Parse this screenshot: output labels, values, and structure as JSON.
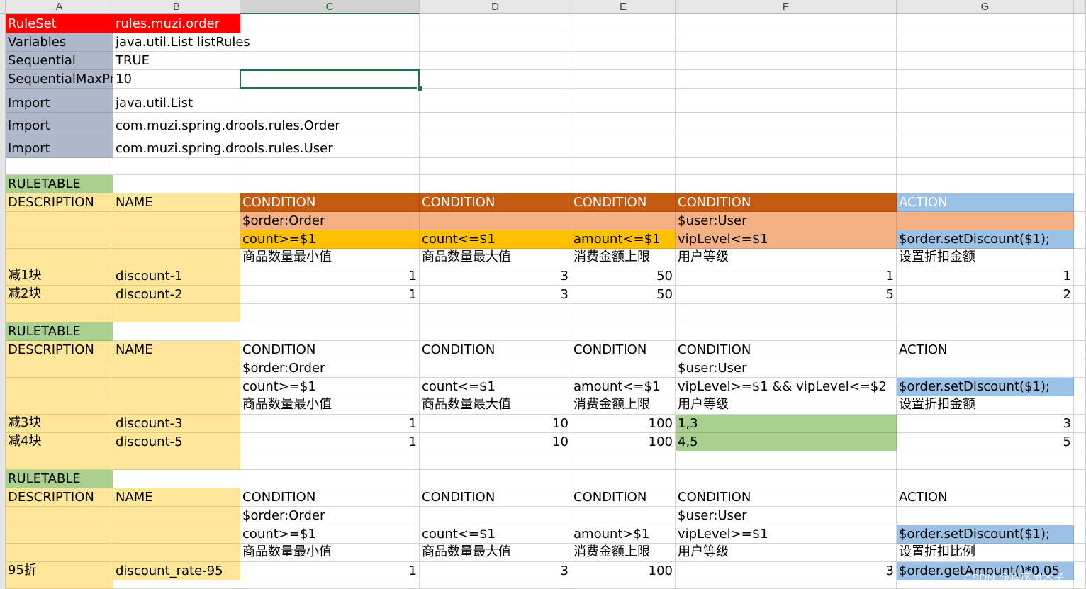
{
  "columns": [
    "A",
    "B",
    "C",
    "D",
    "E",
    "F",
    "G"
  ],
  "active_column": "C",
  "colors": {
    "red": "#ff0000",
    "gray_blue": "#adb9ca",
    "green": "#a9d08e",
    "light_yellow": "#ffe699",
    "dark_orange": "#c55a11",
    "salmon": "#f4b183",
    "gold": "#ffc000",
    "light_blue": "#9bc2e6",
    "white": "#ffffff"
  },
  "rows": [
    [
      {
        "t": "RuleSet",
        "bg": "red",
        "fc": "white"
      },
      {
        "t": "rules.muzi.order",
        "bg": "red",
        "fc": "white"
      },
      {
        "t": ""
      },
      {
        "t": ""
      },
      {
        "t": ""
      },
      {
        "t": ""
      },
      {
        "t": ""
      }
    ],
    [
      {
        "t": "Variables",
        "bg": "gray_blue"
      },
      {
        "t": "java.util.List listRules",
        "ov": true
      },
      {
        "t": ""
      },
      {
        "t": ""
      },
      {
        "t": ""
      },
      {
        "t": ""
      },
      {
        "t": ""
      }
    ],
    [
      {
        "t": "Sequential",
        "bg": "gray_blue"
      },
      {
        "t": "TRUE"
      },
      {
        "t": ""
      },
      {
        "t": ""
      },
      {
        "t": ""
      },
      {
        "t": ""
      },
      {
        "t": ""
      }
    ],
    [
      {
        "t": "SequentialMaxPriority",
        "bg": "gray_blue"
      },
      {
        "t": "10"
      },
      {
        "t": ""
      },
      {
        "t": ""
      },
      {
        "t": ""
      },
      {
        "t": ""
      },
      {
        "t": ""
      }
    ],
    [
      {
        "t": "Import",
        "bg": "gray_blue"
      },
      {
        "t": "java.util.List"
      },
      {
        "t": ""
      },
      {
        "t": ""
      },
      {
        "t": ""
      },
      {
        "t": ""
      },
      {
        "t": ""
      }
    ],
    [
      {
        "t": "Import",
        "bg": "gray_blue"
      },
      {
        "t": "com.muzi.spring.drools.rules.Order",
        "ov": true
      },
      {
        "t": ""
      },
      {
        "t": ""
      },
      {
        "t": ""
      },
      {
        "t": ""
      },
      {
        "t": ""
      }
    ],
    [
      {
        "t": "Import",
        "bg": "gray_blue"
      },
      {
        "t": "com.muzi.spring.drools.rules.User",
        "ov": true
      },
      {
        "t": ""
      },
      {
        "t": ""
      },
      {
        "t": ""
      },
      {
        "t": ""
      },
      {
        "t": ""
      }
    ],
    [
      {
        "t": ""
      },
      {
        "t": ""
      },
      {
        "t": ""
      },
      {
        "t": ""
      },
      {
        "t": ""
      },
      {
        "t": ""
      },
      {
        "t": ""
      }
    ],
    [
      {
        "t": "RULETABLE",
        "bg": "green"
      },
      {
        "t": ""
      },
      {
        "t": ""
      },
      {
        "t": ""
      },
      {
        "t": ""
      },
      {
        "t": ""
      },
      {
        "t": ""
      }
    ],
    [
      {
        "t": "DESCRIPTION",
        "bg": "light_yellow"
      },
      {
        "t": "NAME",
        "bg": "light_yellow"
      },
      {
        "t": "CONDITION",
        "bg": "dark_orange",
        "fc": "white"
      },
      {
        "t": "CONDITION",
        "bg": "dark_orange",
        "fc": "white"
      },
      {
        "t": "CONDITION",
        "bg": "dark_orange",
        "fc": "white"
      },
      {
        "t": "CONDITION",
        "bg": "dark_orange",
        "fc": "white"
      },
      {
        "t": "ACTION",
        "bg": "light_blue",
        "fc": "white"
      }
    ],
    [
      {
        "t": "",
        "bg": "light_yellow"
      },
      {
        "t": "",
        "bg": "light_yellow"
      },
      {
        "t": "$order:Order",
        "bg": "salmon"
      },
      {
        "t": "",
        "bg": "salmon"
      },
      {
        "t": "",
        "bg": "salmon"
      },
      {
        "t": "$user:User",
        "bg": "salmon"
      },
      {
        "t": "",
        "bg": "salmon"
      }
    ],
    [
      {
        "t": "",
        "bg": "light_yellow"
      },
      {
        "t": "",
        "bg": "light_yellow"
      },
      {
        "t": "count>=$1",
        "bg": "gold"
      },
      {
        "t": "count<=$1",
        "bg": "gold"
      },
      {
        "t": "amount<=$1",
        "bg": "gold"
      },
      {
        "t": "vipLevel<=$1",
        "bg": "salmon"
      },
      {
        "t": "$order.setDiscount($1);",
        "bg": "light_blue"
      }
    ],
    [
      {
        "t": "",
        "bg": "light_yellow"
      },
      {
        "t": "",
        "bg": "light_yellow"
      },
      {
        "t": "商品数量最小值"
      },
      {
        "t": "商品数量最大值"
      },
      {
        "t": "消费金额上限"
      },
      {
        "t": "用户等级"
      },
      {
        "t": "设置折扣金额"
      }
    ],
    [
      {
        "t": "减1块",
        "bg": "light_yellow"
      },
      {
        "t": "discount-1",
        "bg": "light_yellow"
      },
      {
        "t": "1",
        "num": true
      },
      {
        "t": "3",
        "num": true
      },
      {
        "t": "50",
        "num": true
      },
      {
        "t": "1",
        "num": true
      },
      {
        "t": "1",
        "num": true
      }
    ],
    [
      {
        "t": "减2块",
        "bg": "light_yellow"
      },
      {
        "t": "discount-2",
        "bg": "light_yellow"
      },
      {
        "t": "1",
        "num": true
      },
      {
        "t": "3",
        "num": true
      },
      {
        "t": "50",
        "num": true
      },
      {
        "t": "5",
        "num": true
      },
      {
        "t": "2",
        "num": true
      }
    ],
    [
      {
        "t": "",
        "bg": "light_yellow"
      },
      {
        "t": "",
        "bg": "light_yellow"
      },
      {
        "t": ""
      },
      {
        "t": ""
      },
      {
        "t": ""
      },
      {
        "t": ""
      },
      {
        "t": ""
      }
    ],
    [
      {
        "t": "RULETABLE",
        "bg": "green"
      },
      {
        "t": ""
      },
      {
        "t": ""
      },
      {
        "t": ""
      },
      {
        "t": ""
      },
      {
        "t": ""
      },
      {
        "t": ""
      }
    ],
    [
      {
        "t": "DESCRIPTION",
        "bg": "light_yellow"
      },
      {
        "t": "NAME",
        "bg": "light_yellow"
      },
      {
        "t": "CONDITION"
      },
      {
        "t": "CONDITION"
      },
      {
        "t": "CONDITION"
      },
      {
        "t": "CONDITION"
      },
      {
        "t": "ACTION"
      }
    ],
    [
      {
        "t": "",
        "bg": "light_yellow"
      },
      {
        "t": "",
        "bg": "light_yellow"
      },
      {
        "t": "$order:Order"
      },
      {
        "t": ""
      },
      {
        "t": ""
      },
      {
        "t": "$user:User"
      },
      {
        "t": ""
      }
    ],
    [
      {
        "t": "",
        "bg": "light_yellow"
      },
      {
        "t": "",
        "bg": "light_yellow"
      },
      {
        "t": "count>=$1"
      },
      {
        "t": "count<=$1"
      },
      {
        "t": "amount<=$1"
      },
      {
        "t": "vipLevel>=$1 && vipLevel<=$2"
      },
      {
        "t": "$order.setDiscount($1);",
        "bg": "light_blue"
      }
    ],
    [
      {
        "t": "",
        "bg": "light_yellow"
      },
      {
        "t": "",
        "bg": "light_yellow"
      },
      {
        "t": "商品数量最小值"
      },
      {
        "t": "商品数量最大值"
      },
      {
        "t": "消费金额上限"
      },
      {
        "t": "用户等级"
      },
      {
        "t": "设置折扣金额"
      }
    ],
    [
      {
        "t": "减3块",
        "bg": "light_yellow"
      },
      {
        "t": "discount-3",
        "bg": "light_yellow"
      },
      {
        "t": "1",
        "num": true
      },
      {
        "t": "10",
        "num": true
      },
      {
        "t": "100",
        "num": true
      },
      {
        "t": "1,3",
        "bg": "green"
      },
      {
        "t": "3",
        "num": true
      }
    ],
    [
      {
        "t": "减4块",
        "bg": "light_yellow"
      },
      {
        "t": "discount-5",
        "bg": "light_yellow"
      },
      {
        "t": "1",
        "num": true
      },
      {
        "t": "10",
        "num": true
      },
      {
        "t": "100",
        "num": true
      },
      {
        "t": "4,5",
        "bg": "green"
      },
      {
        "t": "5",
        "num": true
      }
    ],
    [
      {
        "t": "",
        "bg": "light_yellow"
      },
      {
        "t": "",
        "bg": "light_yellow"
      },
      {
        "t": ""
      },
      {
        "t": ""
      },
      {
        "t": ""
      },
      {
        "t": ""
      },
      {
        "t": ""
      }
    ],
    [
      {
        "t": "RULETABLE",
        "bg": "green"
      },
      {
        "t": ""
      },
      {
        "t": ""
      },
      {
        "t": ""
      },
      {
        "t": ""
      },
      {
        "t": ""
      },
      {
        "t": ""
      }
    ],
    [
      {
        "t": "DESCRIPTION",
        "bg": "light_yellow"
      },
      {
        "t": "NAME",
        "bg": "light_yellow"
      },
      {
        "t": "CONDITION"
      },
      {
        "t": "CONDITION"
      },
      {
        "t": "CONDITION"
      },
      {
        "t": "CONDITION"
      },
      {
        "t": "ACTION"
      }
    ],
    [
      {
        "t": "",
        "bg": "light_yellow"
      },
      {
        "t": "",
        "bg": "light_yellow"
      },
      {
        "t": "$order:Order"
      },
      {
        "t": ""
      },
      {
        "t": ""
      },
      {
        "t": "$user:User"
      },
      {
        "t": ""
      }
    ],
    [
      {
        "t": "",
        "bg": "light_yellow"
      },
      {
        "t": "",
        "bg": "light_yellow"
      },
      {
        "t": "count>=$1"
      },
      {
        "t": "count<=$1"
      },
      {
        "t": "amount>$1"
      },
      {
        "t": "vipLevel>=$1"
      },
      {
        "t": "$order.setDiscount($1);",
        "bg": "light_blue"
      }
    ],
    [
      {
        "t": "",
        "bg": "light_yellow"
      },
      {
        "t": "",
        "bg": "light_yellow"
      },
      {
        "t": "商品数量最小值"
      },
      {
        "t": "商品数量最大值"
      },
      {
        "t": "消费金额上限"
      },
      {
        "t": "用户等级"
      },
      {
        "t": "设置折扣比例"
      }
    ],
    [
      {
        "t": "95折",
        "bg": "light_yellow"
      },
      {
        "t": "discount_rate-95",
        "bg": "light_yellow"
      },
      {
        "t": "1",
        "num": true
      },
      {
        "t": "3",
        "num": true
      },
      {
        "t": "100",
        "num": true
      },
      {
        "t": "3",
        "num": true
      },
      {
        "t": "$order.getAmount()*0.05",
        "bg": "light_blue"
      }
    ],
    [
      {
        "t": "",
        "bg": "light_yellow"
      },
      {
        "t": ""
      },
      {
        "t": ""
      },
      {
        "t": ""
      },
      {
        "t": ""
      },
      {
        "t": ""
      },
      {
        "t": ""
      }
    ]
  ],
  "selected_cell": {
    "row": 4,
    "col": "C"
  },
  "watermark": "CSDN @程序员木子"
}
